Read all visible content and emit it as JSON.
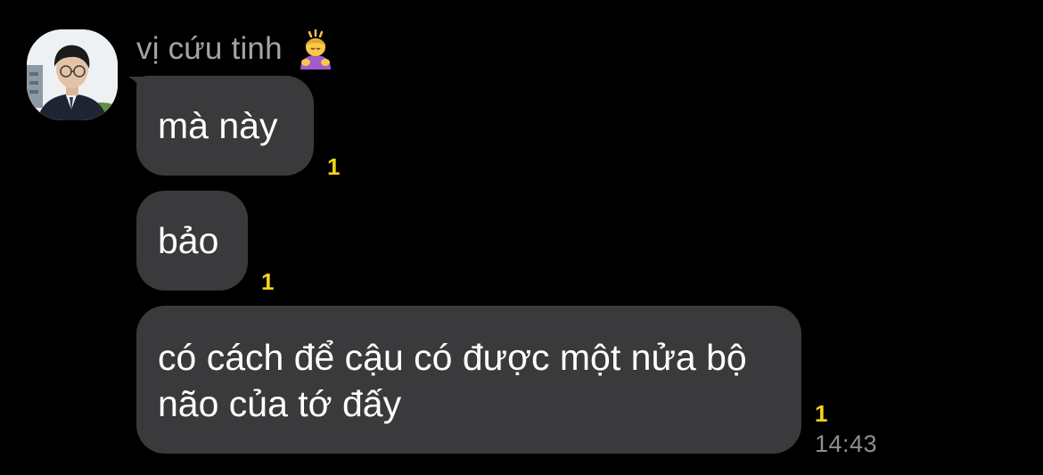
{
  "chat": {
    "sender_name": "vị cứu tinh",
    "messages": [
      {
        "text": "mà này",
        "unread_count": "1"
      },
      {
        "text": "bảo",
        "unread_count": "1"
      },
      {
        "text": "có cách để cậu có được một nửa bộ não của tớ đấy",
        "unread_count": "1",
        "time": "14:43"
      }
    ]
  },
  "icons": {
    "avatar": "profile-photo",
    "name_emoji": "person-bowing-emoji"
  },
  "colors": {
    "background": "#000000",
    "bubble": "#3a3a3c",
    "message_text": "#ffffff",
    "sender_name": "#a3a3a8",
    "unread_count": "#f5d316",
    "time": "#8e8e93"
  }
}
